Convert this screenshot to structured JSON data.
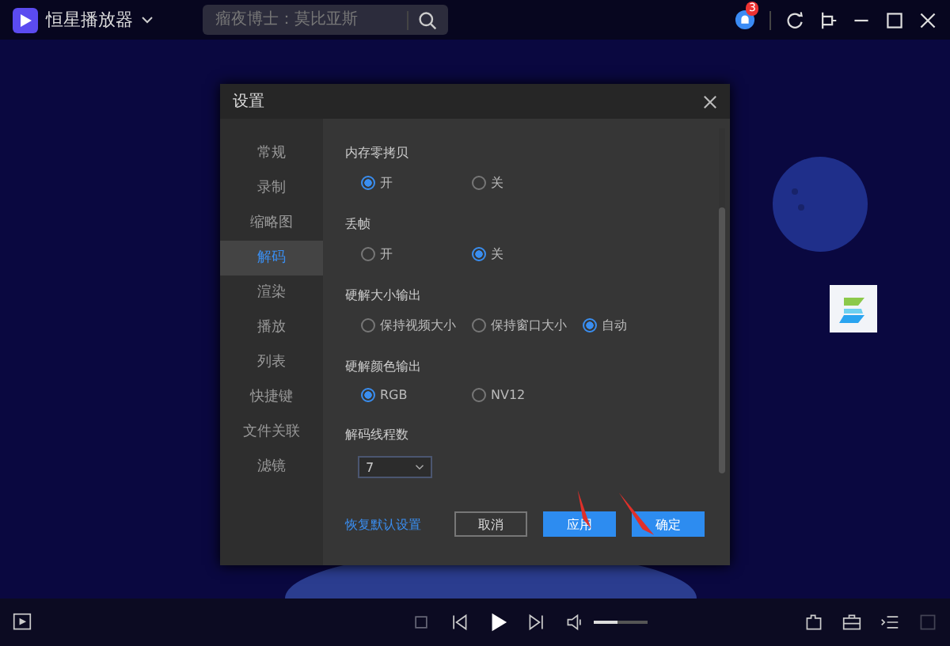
{
  "app": {
    "title": "恒星播放器",
    "search_placeholder": "瘤夜博士：莫比亚斯",
    "notification_count": "3"
  },
  "dialog": {
    "title": "设置",
    "sidebar": [
      {
        "label": "常规",
        "selected": false
      },
      {
        "label": "录制",
        "selected": false
      },
      {
        "label": "缩略图",
        "selected": false
      },
      {
        "label": "解码",
        "selected": true
      },
      {
        "label": "渲染",
        "selected": false
      },
      {
        "label": "播放",
        "selected": false
      },
      {
        "label": "列表",
        "selected": false
      },
      {
        "label": "快捷键",
        "selected": false
      },
      {
        "label": "文件关联",
        "selected": false
      },
      {
        "label": "滤镜",
        "selected": false
      }
    ],
    "groups": [
      {
        "kind": "radio",
        "label": "内存零拷贝",
        "options": [
          {
            "label": "开",
            "selected": true
          },
          {
            "label": "关",
            "selected": false
          }
        ]
      },
      {
        "kind": "radio",
        "label": "丢帧",
        "options": [
          {
            "label": "开",
            "selected": false
          },
          {
            "label": "关",
            "selected": true
          }
        ]
      },
      {
        "kind": "radio",
        "label": "硬解大小输出",
        "options": [
          {
            "label": "保持视频大小",
            "selected": false
          },
          {
            "label": "保持窗口大小",
            "selected": false
          },
          {
            "label": "自动",
            "selected": true
          }
        ]
      },
      {
        "kind": "radio",
        "label": "硬解颜色输出",
        "options": [
          {
            "label": "RGB",
            "selected": true
          },
          {
            "label": "NV12",
            "selected": false
          }
        ]
      },
      {
        "kind": "select",
        "label": "解码线程数",
        "value": "7"
      }
    ],
    "reset_link": "恢复默认设置",
    "buttons": [
      {
        "label": "取消",
        "kind": "secondary"
      },
      {
        "label": "应用",
        "kind": "primary"
      },
      {
        "label": "确定",
        "kind": "primary"
      }
    ]
  },
  "player": {
    "volume": {
      "level": 0.45
    }
  }
}
